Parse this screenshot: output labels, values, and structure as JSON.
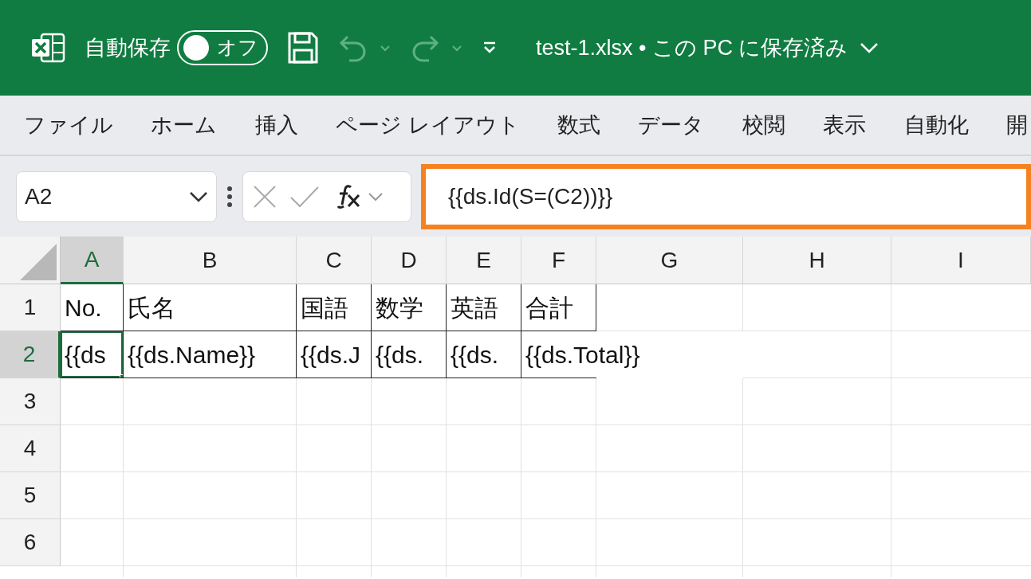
{
  "title_bar": {
    "autosave_label": "自動保存",
    "autosave": {
      "on": false,
      "label": "オフ"
    },
    "quick_access": [
      {
        "kind": "save",
        "disabled": false
      },
      {
        "kind": "undo",
        "disabled": true
      },
      {
        "kind": "redo",
        "disabled": true
      },
      {
        "kind": "customize",
        "disabled": false
      }
    ],
    "document_title": "test-1.xlsx • この PC に保存済み"
  },
  "ribbon_tabs": [
    {
      "label": "ファイル"
    },
    {
      "label": "ホーム"
    },
    {
      "label": "挿入"
    },
    {
      "label": "ページ レイアウト"
    },
    {
      "label": "数式"
    },
    {
      "label": "データ"
    },
    {
      "label": "校閲"
    },
    {
      "label": "表示"
    },
    {
      "label": "自動化"
    },
    {
      "label": "開"
    }
  ],
  "formula_bar": {
    "name_box": "A2",
    "formula": "{{ds.Id(S=(C2))}}",
    "highlighted": true
  },
  "sheet": {
    "columns": [
      {
        "label": "A",
        "selected": true
      },
      {
        "label": "B",
        "selected": false
      },
      {
        "label": "C",
        "selected": false
      },
      {
        "label": "D",
        "selected": false
      },
      {
        "label": "E",
        "selected": false
      },
      {
        "label": "F",
        "selected": false
      },
      {
        "label": "G",
        "selected": false
      },
      {
        "label": "H",
        "selected": false
      },
      {
        "label": "I",
        "selected": false
      }
    ],
    "rows": [
      {
        "label": "1",
        "selected": false,
        "cells": [
          {
            "text": "No.",
            "selected": false
          },
          {
            "text": "氏名",
            "selected": false
          },
          {
            "text": "国語",
            "selected": false
          },
          {
            "text": "数学",
            "selected": false
          },
          {
            "text": "英語",
            "selected": false
          },
          {
            "text": "合計",
            "selected": false
          }
        ]
      },
      {
        "label": "2",
        "selected": true,
        "cells": [
          {
            "text": "{{ds",
            "selected": true
          },
          {
            "text": "{{ds.Name}}",
            "selected": false
          },
          {
            "text": "{{ds.J",
            "selected": false
          },
          {
            "text": "{{ds.",
            "selected": false
          },
          {
            "text": "{{ds.",
            "selected": false
          },
          {
            "text": "{{ds.Total}}",
            "selected": false
          }
        ]
      },
      {
        "label": "3",
        "selected": false
      },
      {
        "label": "4",
        "selected": false
      },
      {
        "label": "5",
        "selected": false
      },
      {
        "label": "6",
        "selected": false
      }
    ]
  }
}
